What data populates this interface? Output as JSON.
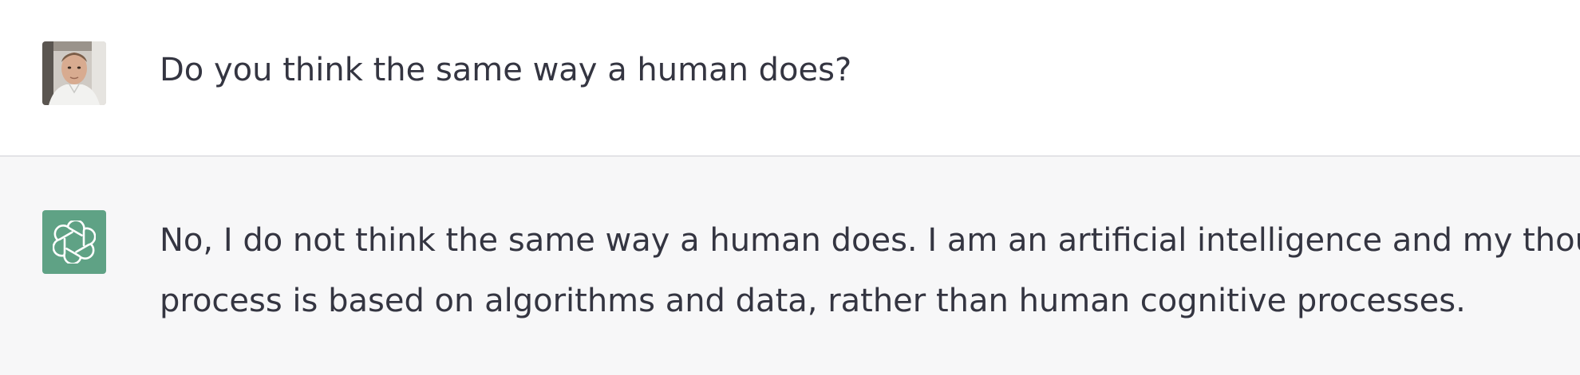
{
  "conversation": {
    "user_message": {
      "avatar_icon": "user-photo-avatar",
      "text": "Do you think the same way a human does?"
    },
    "assistant_message": {
      "avatar_icon": "openai-logo-icon",
      "avatar_color": "#5fa285",
      "line1": "No, I do not think the same way a human does. I am an artificial intelligence and my thought",
      "line2": "process is based on algorithms and data, rather than human cognitive processes."
    },
    "colors": {
      "user_bg": "#ffffff",
      "assistant_bg": "#f7f7f8",
      "text": "#343541"
    }
  }
}
